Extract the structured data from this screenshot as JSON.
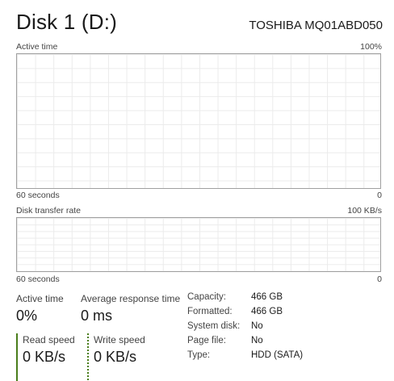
{
  "header": {
    "title": "Disk 1 (D:)",
    "model": "TOSHIBA MQ01ABD050"
  },
  "active_time_chart": {
    "label": "Active time",
    "max_label": "100%",
    "time_label": "60 seconds",
    "min_label": "0"
  },
  "transfer_rate_chart": {
    "label": "Disk transfer rate",
    "max_label": "100 KB/s",
    "time_label": "60 seconds",
    "min_label": "0"
  },
  "stats": {
    "active_time": {
      "label": "Active time",
      "value": "0%"
    },
    "avg_response": {
      "label": "Average response time",
      "value": "0 ms"
    },
    "read_speed": {
      "label": "Read speed",
      "value": "0 KB/s"
    },
    "write_speed": {
      "label": "Write speed",
      "value": "0 KB/s"
    }
  },
  "info": [
    {
      "key": "Capacity:",
      "value": "466 GB"
    },
    {
      "key": "Formatted:",
      "value": "466 GB"
    },
    {
      "key": "System disk:",
      "value": "No"
    },
    {
      "key": "Page file:",
      "value": "No"
    },
    {
      "key": "Type:",
      "value": "HDD (SATA)"
    }
  ],
  "colors": {
    "accent": "#4a7d1b",
    "chart_border": "#a0a0a0",
    "grid": "#ebebeb"
  }
}
